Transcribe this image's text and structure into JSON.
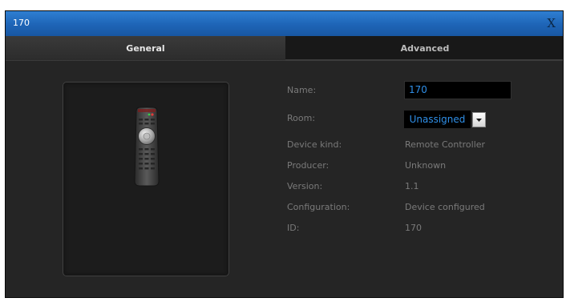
{
  "window": {
    "title": "170",
    "close_label": "X"
  },
  "tabs": [
    {
      "label": "General",
      "active": true
    },
    {
      "label": "Advanced",
      "active": false
    }
  ],
  "device_icon": "remote-controller-icon",
  "properties": {
    "name": {
      "label": "Name:",
      "value": "170"
    },
    "room": {
      "label": "Room:",
      "value": "Unassigned"
    },
    "device_kind": {
      "label": "Device kind:",
      "value": "Remote Controller"
    },
    "producer": {
      "label": "Producer:",
      "value": "Unknown"
    },
    "version": {
      "label": "Version:",
      "value": "1.1"
    },
    "configuration": {
      "label": "Configuration:",
      "value": "Device configured"
    },
    "id": {
      "label": "ID:",
      "value": "170"
    }
  },
  "colors": {
    "titlebar": "#1e64b6",
    "accent_text": "#2f8fe8",
    "panel_bg": "#252525"
  }
}
